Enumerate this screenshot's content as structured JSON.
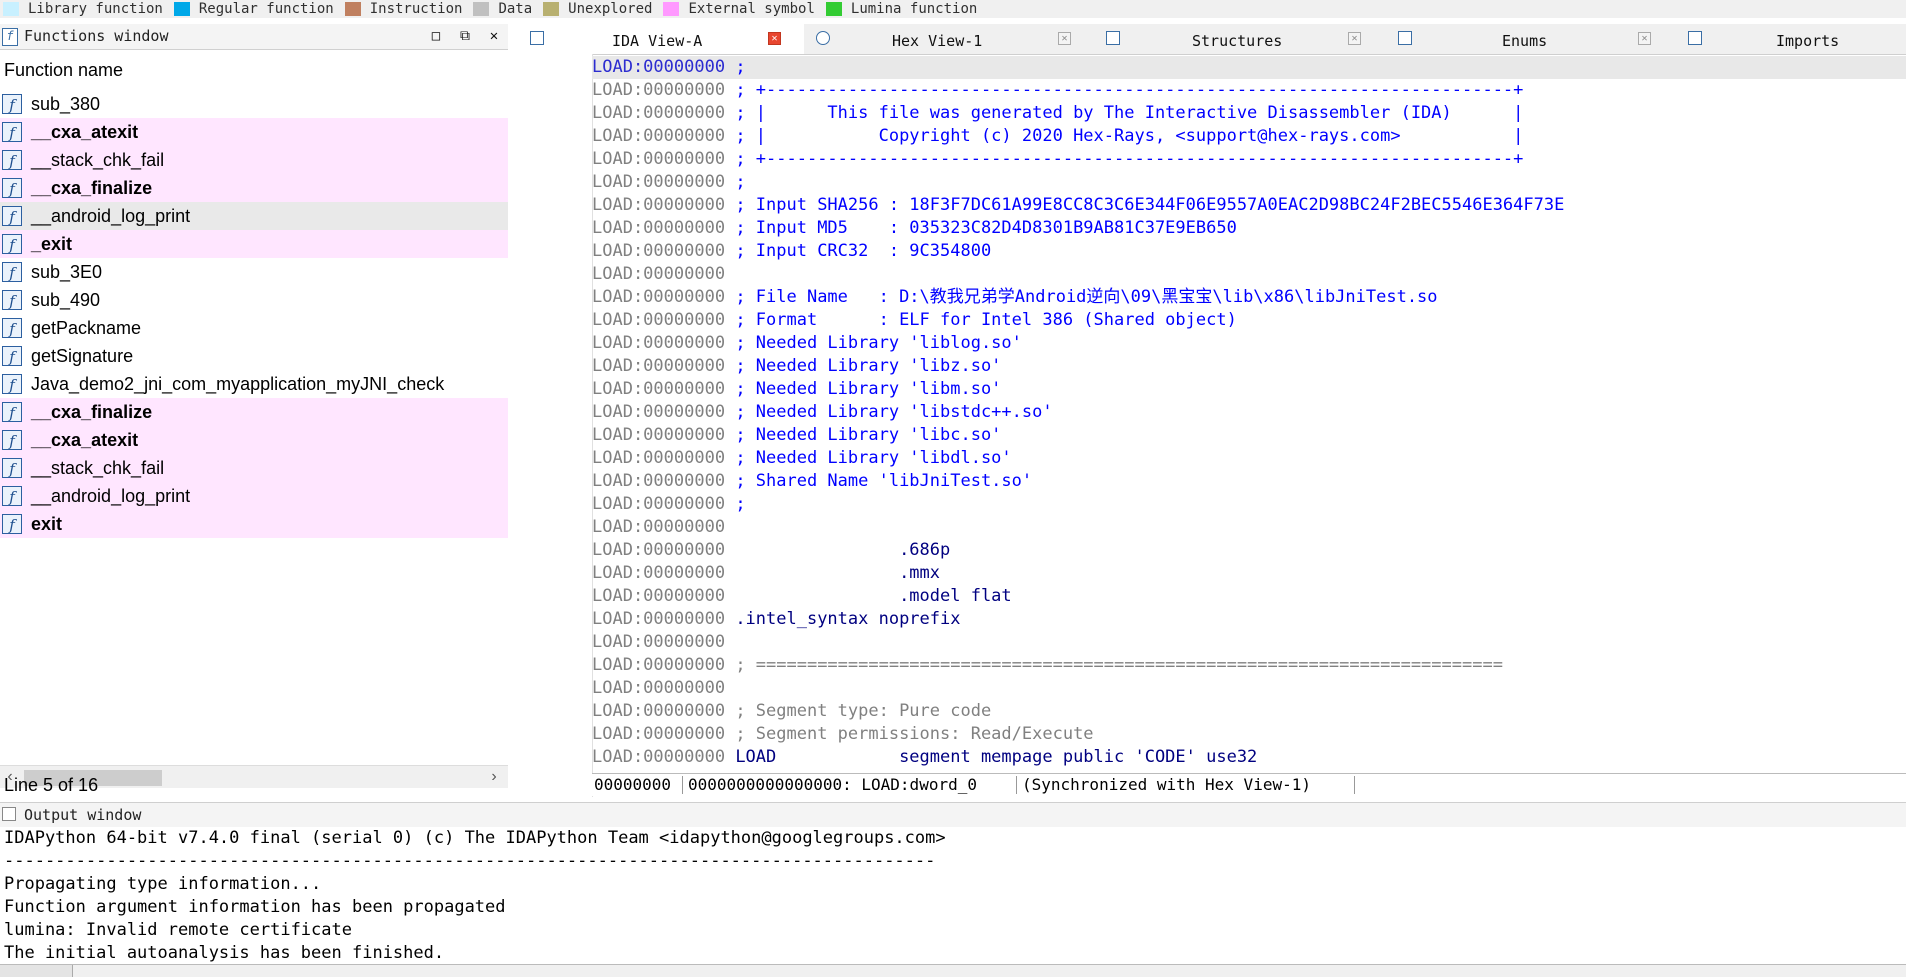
{
  "legend": [
    {
      "label": "Library function",
      "color": "#c8f0ff"
    },
    {
      "label": "Regular function",
      "color": "#00a8e8"
    },
    {
      "label": "Instruction",
      "color": "#c08060"
    },
    {
      "label": "Data",
      "color": "#c0c0c0"
    },
    {
      "label": "Unexplored",
      "color": "#b8b070"
    },
    {
      "label": "External symbol",
      "color": "#ff99ff"
    },
    {
      "label": "Lumina function",
      "color": "#33cc33"
    }
  ],
  "functions_window": {
    "title": "Functions window",
    "column_header": "Function name",
    "status": "Line 5 of 16",
    "functions": [
      {
        "name": "sub_380",
        "bold": false,
        "pink": false,
        "selected": false
      },
      {
        "name": "__cxa_atexit",
        "bold": true,
        "pink": true,
        "selected": false
      },
      {
        "name": "__stack_chk_fail",
        "bold": false,
        "pink": true,
        "selected": false
      },
      {
        "name": "__cxa_finalize",
        "bold": true,
        "pink": true,
        "selected": false
      },
      {
        "name": "__android_log_print",
        "bold": false,
        "pink": true,
        "selected": true
      },
      {
        "name": "_exit",
        "bold": true,
        "pink": true,
        "selected": false
      },
      {
        "name": "sub_3E0",
        "bold": false,
        "pink": false,
        "selected": false
      },
      {
        "name": "sub_490",
        "bold": false,
        "pink": false,
        "selected": false
      },
      {
        "name": "getPackname",
        "bold": false,
        "pink": false,
        "selected": false
      },
      {
        "name": "getSignature",
        "bold": false,
        "pink": false,
        "selected": false
      },
      {
        "name": "Java_demo2_jni_com_myapplication_myJNI_check",
        "bold": false,
        "pink": false,
        "selected": false
      },
      {
        "name": "__cxa_finalize",
        "bold": true,
        "pink": true,
        "selected": false
      },
      {
        "name": "__cxa_atexit",
        "bold": true,
        "pink": true,
        "selected": false
      },
      {
        "name": "__stack_chk_fail",
        "bold": false,
        "pink": true,
        "selected": false
      },
      {
        "name": "__android_log_print",
        "bold": false,
        "pink": true,
        "selected": false
      },
      {
        "name": "exit",
        "bold": true,
        "pink": true,
        "selected": false
      }
    ]
  },
  "tabs": [
    {
      "label": "IDA View-A",
      "active": true
    },
    {
      "label": "Hex View-1",
      "active": false
    },
    {
      "label": "Structures",
      "active": false
    },
    {
      "label": "Enums",
      "active": false
    },
    {
      "label": "Imports",
      "active": false
    }
  ],
  "disassembly": {
    "address": "LOAD:00000000",
    "lines": [
      {
        "text": ";",
        "cls": "blue"
      },
      {
        "text": "; +-------------------------------------------------------------------------+",
        "cls": "blue"
      },
      {
        "text": "; |      This file was generated by The Interactive Disassembler (IDA)      |",
        "cls": "blue"
      },
      {
        "text": "; |           Copyright (c) 2020 Hex-Rays, <support@hex-rays.com>           |",
        "cls": "blue"
      },
      {
        "text": "; +-------------------------------------------------------------------------+",
        "cls": "blue"
      },
      {
        "text": ";",
        "cls": "blue"
      },
      {
        "text": "; Input SHA256 : 18F3F7DC61A99E8CC8C3C6E344F06E9557A0EAC2D98BC24F2BEC5546E364F73E",
        "cls": "blue"
      },
      {
        "text": "; Input MD5    : 035323C82D4D8301B9AB81C37E9EB650",
        "cls": "blue"
      },
      {
        "text": "; Input CRC32  : 9C354800",
        "cls": "blue"
      },
      {
        "text": "",
        "cls": "blue"
      },
      {
        "text": "; File Name   : D:\\教我兄弟学Android逆向\\09\\黑宝宝\\lib\\x86\\libJniTest.so",
        "cls": "blue"
      },
      {
        "text": "; Format      : ELF for Intel 386 (Shared object)",
        "cls": "blue"
      },
      {
        "text": "; Needed Library 'liblog.so'",
        "cls": "blue"
      },
      {
        "text": "; Needed Library 'libz.so'",
        "cls": "blue"
      },
      {
        "text": "; Needed Library 'libm.so'",
        "cls": "blue"
      },
      {
        "text": "; Needed Library 'libstdc++.so'",
        "cls": "blue"
      },
      {
        "text": "; Needed Library 'libc.so'",
        "cls": "blue"
      },
      {
        "text": "; Needed Library 'libdl.so'",
        "cls": "blue"
      },
      {
        "text": "; Shared Name 'libJniTest.so'",
        "cls": "blue"
      },
      {
        "text": ";",
        "cls": "blue"
      },
      {
        "text": "",
        "cls": "blue"
      },
      {
        "text": "                .686p",
        "cls": "navy"
      },
      {
        "text": "                .mmx",
        "cls": "navy"
      },
      {
        "text": "                .model flat",
        "cls": "navy"
      },
      {
        "text": ".intel_syntax noprefix",
        "cls": "navy"
      },
      {
        "text": "",
        "cls": "blue"
      },
      {
        "text": "; =========================================================================",
        "cls": "gray"
      },
      {
        "text": "",
        "cls": "blue"
      },
      {
        "text": "; Segment type: Pure code",
        "cls": "gray"
      },
      {
        "text": "; Segment permissions: Read/Execute",
        "cls": "gray"
      },
      {
        "text": "LOAD            segment mempage public 'CODE' use32",
        "cls": "navy"
      }
    ]
  },
  "disasm_status": {
    "offset": "00000000",
    "location": "0000000000000000: LOAD:dword_0",
    "sync": "(Synchronized with Hex View-1)"
  },
  "output_window": {
    "title": "Output window",
    "lines": [
      "IDAPython 64-bit v7.4.0 final (serial 0) (c) The IDAPython Team <idapython@googlegroups.com>",
      "-------------------------------------------------------------------------------------------",
      "Propagating type information...",
      "Function argument information has been propagated",
      "lumina: Invalid remote certificate",
      "The initial autoanalysis has been finished."
    ]
  }
}
